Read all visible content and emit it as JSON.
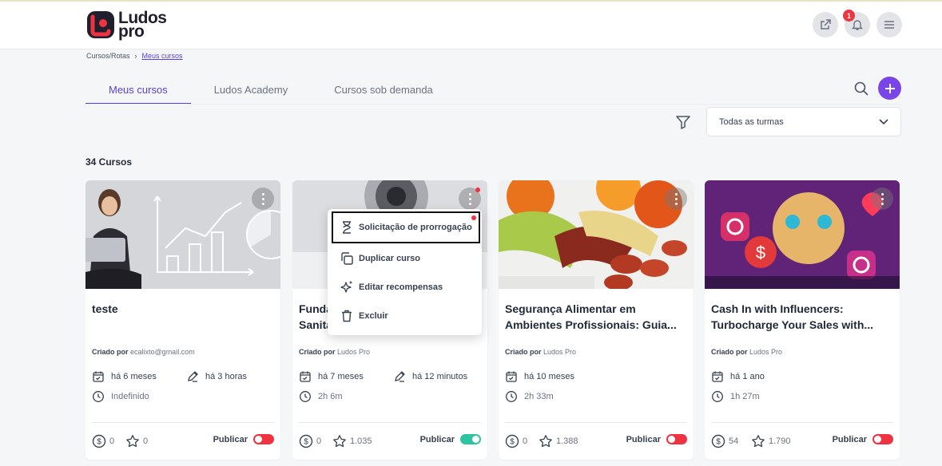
{
  "app": {
    "logo_line1": "Ludos",
    "logo_line2": "pro",
    "notification_count": "1"
  },
  "breadcrumb": {
    "root": "Cursos/Rotas",
    "current": "Meus cursos"
  },
  "tabs": [
    {
      "label": "Meus cursos",
      "active": true
    },
    {
      "label": "Ludos Academy",
      "active": false
    },
    {
      "label": "Cursos sob demanda",
      "active": false
    }
  ],
  "filter": {
    "selected": "Todas as turmas"
  },
  "count_label": "34 Cursos",
  "creator_prefix": "Criado por",
  "publish_label": "Publicar",
  "colors": {
    "accent": "#5b3fd6",
    "add": "#7a45e8",
    "toggle_off": "#ef3340",
    "toggle_on": "#2ec4a0"
  },
  "cards": [
    {
      "title1": "teste",
      "title2": "",
      "creator": "ecalixto@gmail.com",
      "created": "há 6 meses",
      "edited": "há 3 horas",
      "duration": "Indefinido",
      "coins": "0",
      "stars": "0",
      "published": false
    },
    {
      "title1": "Fundamentos de Segurança",
      "title2": "Sanitária",
      "creator": "Ludos Pro",
      "created": "há 7 meses",
      "edited": "há 12 minutos",
      "duration": "2h 6m",
      "coins": "0",
      "stars": "1.035",
      "published": true
    },
    {
      "title1": "Segurança Alimentar em",
      "title2": "Ambientes Profissionais: Guia...",
      "creator": "Ludos Pro",
      "created": "há 10 meses",
      "edited": "",
      "duration": "2h 33m",
      "coins": "0",
      "stars": "1.388",
      "published": false
    },
    {
      "title1": "Cash In with Influencers:",
      "title2": "Turbocharge Your Sales with...",
      "creator": "Ludos Pro",
      "created": "há 1 ano",
      "edited": "",
      "duration": "1h 27m",
      "coins": "54",
      "stars": "1.790",
      "published": false
    }
  ],
  "context_menu": {
    "items": [
      {
        "label": "Solicitação de prorrogação",
        "icon": "hourglass-icon"
      },
      {
        "label": "Duplicar curso",
        "icon": "copy-icon"
      },
      {
        "label": "Editar recompensas",
        "icon": "sparkle-icon"
      },
      {
        "label": "Excluir",
        "icon": "trash-icon"
      }
    ]
  }
}
